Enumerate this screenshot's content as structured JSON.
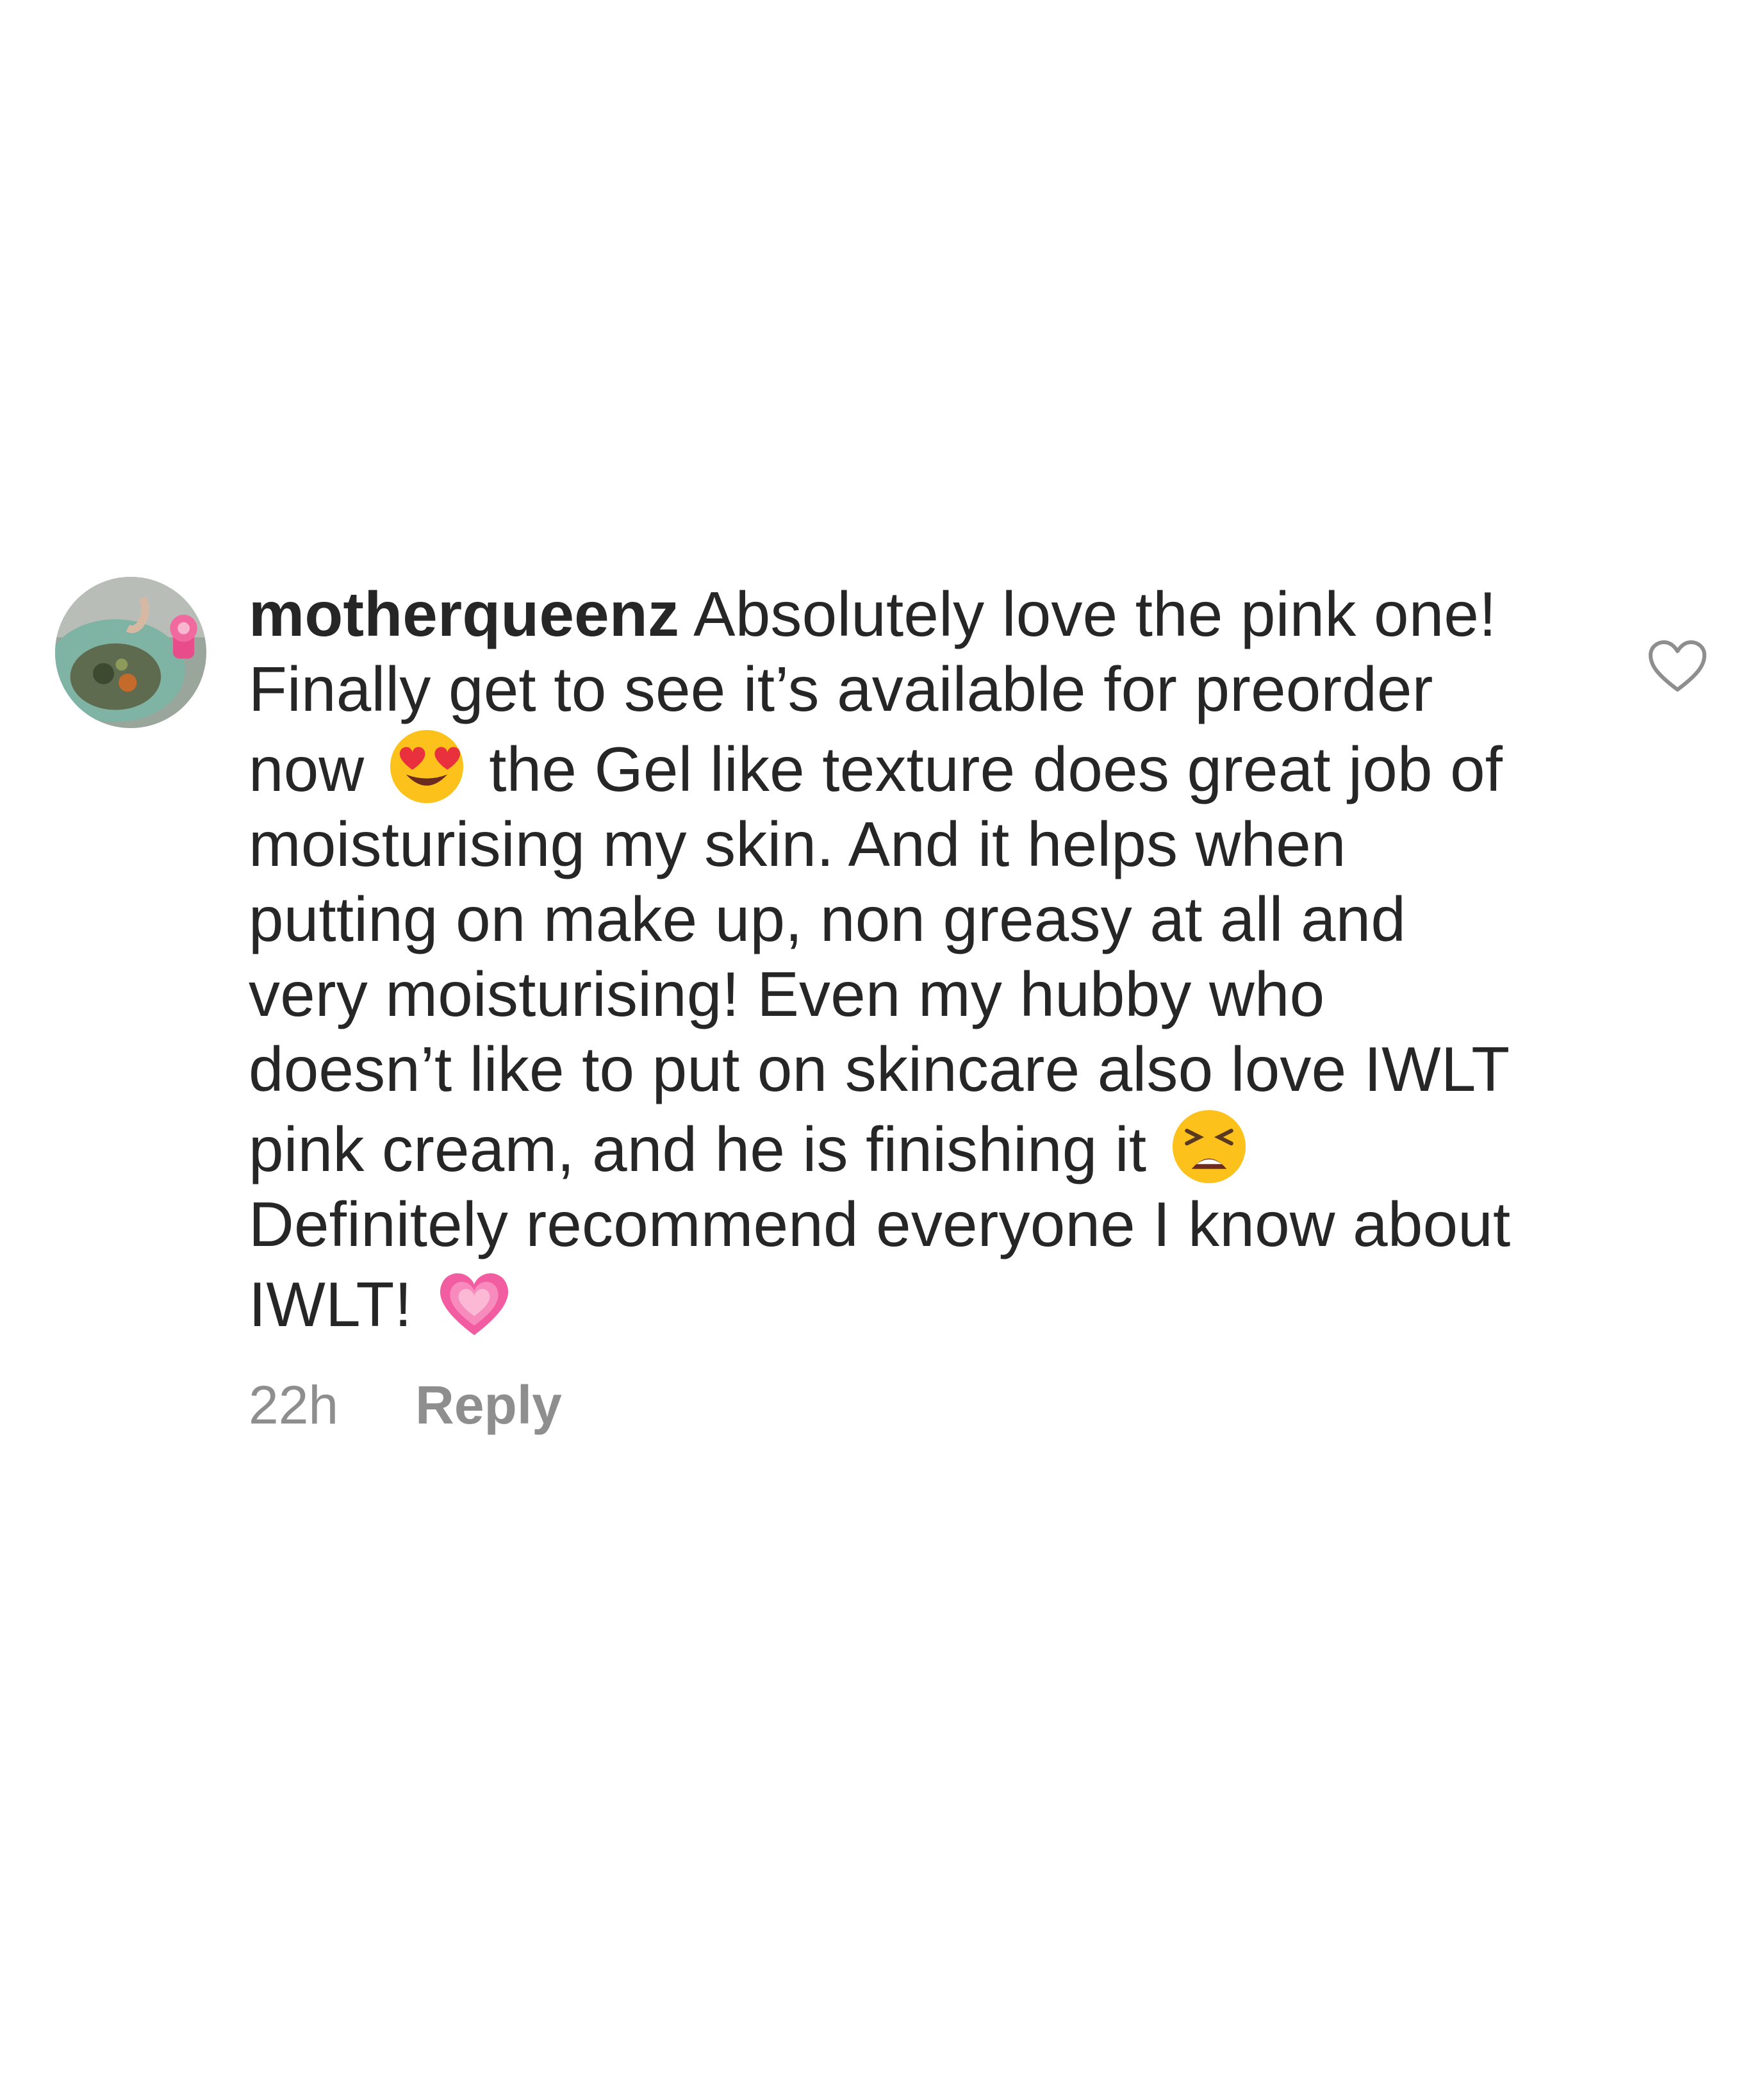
{
  "comment": {
    "username": "motherqueenz",
    "text_parts": [
      " Absolutely love the pink one! Finally get to see it’s available for preorder now ",
      " the Gel like texture does great job of moisturising my skin. And it helps when putting on make up, non greasy at all and very moisturising! Even my hubby who doesn’t like to put on skincare also love IWLT pink cream, and he is finishing it ",
      " Definitely recommend everyone I know about IWLT! "
    ],
    "emojis": [
      "heart-eyes-emoji",
      "tired-face-emoji",
      "growing-heart-emoji"
    ],
    "time": "22h",
    "reply_label": "Reply"
  },
  "colors": {
    "text": "#262626",
    "secondary": "#8e8e8e",
    "background": "#ffffff"
  }
}
